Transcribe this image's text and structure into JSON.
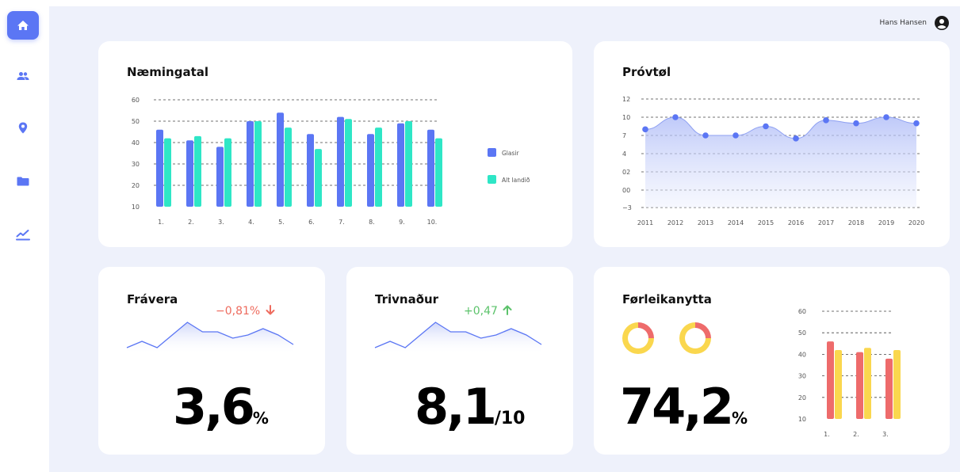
{
  "header": {
    "user_name": "Hans Hansen"
  },
  "sidebar": {
    "items": [
      {
        "icon": "home-icon",
        "active": true
      },
      {
        "icon": "users-icon",
        "active": false
      },
      {
        "icon": "location-pin-icon",
        "active": false
      },
      {
        "icon": "folder-icon",
        "active": false
      },
      {
        "icon": "trend-chart-icon",
        "active": false
      }
    ]
  },
  "colors": {
    "accent": "#5b76f4",
    "teal": "#2ee6c6",
    "red": "#ee6b6b",
    "yellow": "#fad74e",
    "down": "#ee6b5e",
    "up": "#5cc36b"
  },
  "naemingatal": {
    "title": "Næmingatal",
    "legend": [
      "Glasir",
      "Alt landið"
    ]
  },
  "provtol": {
    "title": "Próvtøl"
  },
  "fravera": {
    "title": "Frávera",
    "delta": "−0,81%",
    "value": "3,6",
    "unit": "%"
  },
  "trivnadur": {
    "title": "Trivnaður",
    "delta": "+0,47",
    "value": "8,1",
    "unit": "/10"
  },
  "forleikanytta": {
    "title": "Førleikanytta",
    "value": "74,2",
    "unit": "%"
  },
  "chart_data": [
    {
      "type": "bar",
      "title": "Næmingatal",
      "categories": [
        "1.",
        "2.",
        "3.",
        "4.",
        "5.",
        "6.",
        "7.",
        "8.",
        "9.",
        "10."
      ],
      "series": [
        {
          "name": "Glasir",
          "values": [
            46,
            41,
            38,
            50,
            54,
            44,
            52,
            44,
            49,
            46
          ]
        },
        {
          "name": "Alt landið",
          "values": [
            42,
            43,
            42,
            50,
            47,
            37,
            51,
            47,
            50,
            42
          ]
        }
      ],
      "ylim": [
        10,
        60
      ],
      "yticks": [
        "10",
        "20",
        "30",
        "40",
        "50",
        "60"
      ],
      "grid": true,
      "legend": "right"
    },
    {
      "type": "area",
      "title": "Próvtøl",
      "x": [
        "2011",
        "2012",
        "2013",
        "2014",
        "2015",
        "2016",
        "2017",
        "2018",
        "2019",
        "2020"
      ],
      "values": [
        8,
        10,
        7,
        7,
        8.5,
        6.5,
        9.5,
        9,
        10,
        9
      ],
      "yticks": [
        "12",
        "10",
        "7",
        "4",
        "02",
        "00",
        "−3"
      ],
      "grid": true
    },
    {
      "type": "line",
      "title": "Frávera trend",
      "values": [
        2,
        4,
        2,
        6,
        10,
        7,
        7,
        5,
        6,
        8,
        6,
        3
      ]
    },
    {
      "type": "line",
      "title": "Trivnaður trend",
      "values": [
        2,
        4,
        2,
        6,
        10,
        7,
        7,
        5,
        6,
        8,
        6,
        3
      ]
    },
    {
      "type": "pie",
      "title": "Førleikanytta donuts",
      "donuts": [
        {
          "values": [
            25,
            75
          ]
        },
        {
          "values": [
            25,
            75
          ]
        }
      ]
    },
    {
      "type": "bar",
      "title": "Førleikanytta bars",
      "categories": [
        "1.",
        "2.",
        "3."
      ],
      "series": [
        {
          "values": [
            46,
            41,
            38
          ]
        },
        {
          "values": [
            42,
            43,
            42
          ]
        }
      ],
      "ylim": [
        10,
        60
      ],
      "yticks": [
        "10",
        "20",
        "30",
        "40",
        "50",
        "60"
      ],
      "grid": true
    }
  ]
}
